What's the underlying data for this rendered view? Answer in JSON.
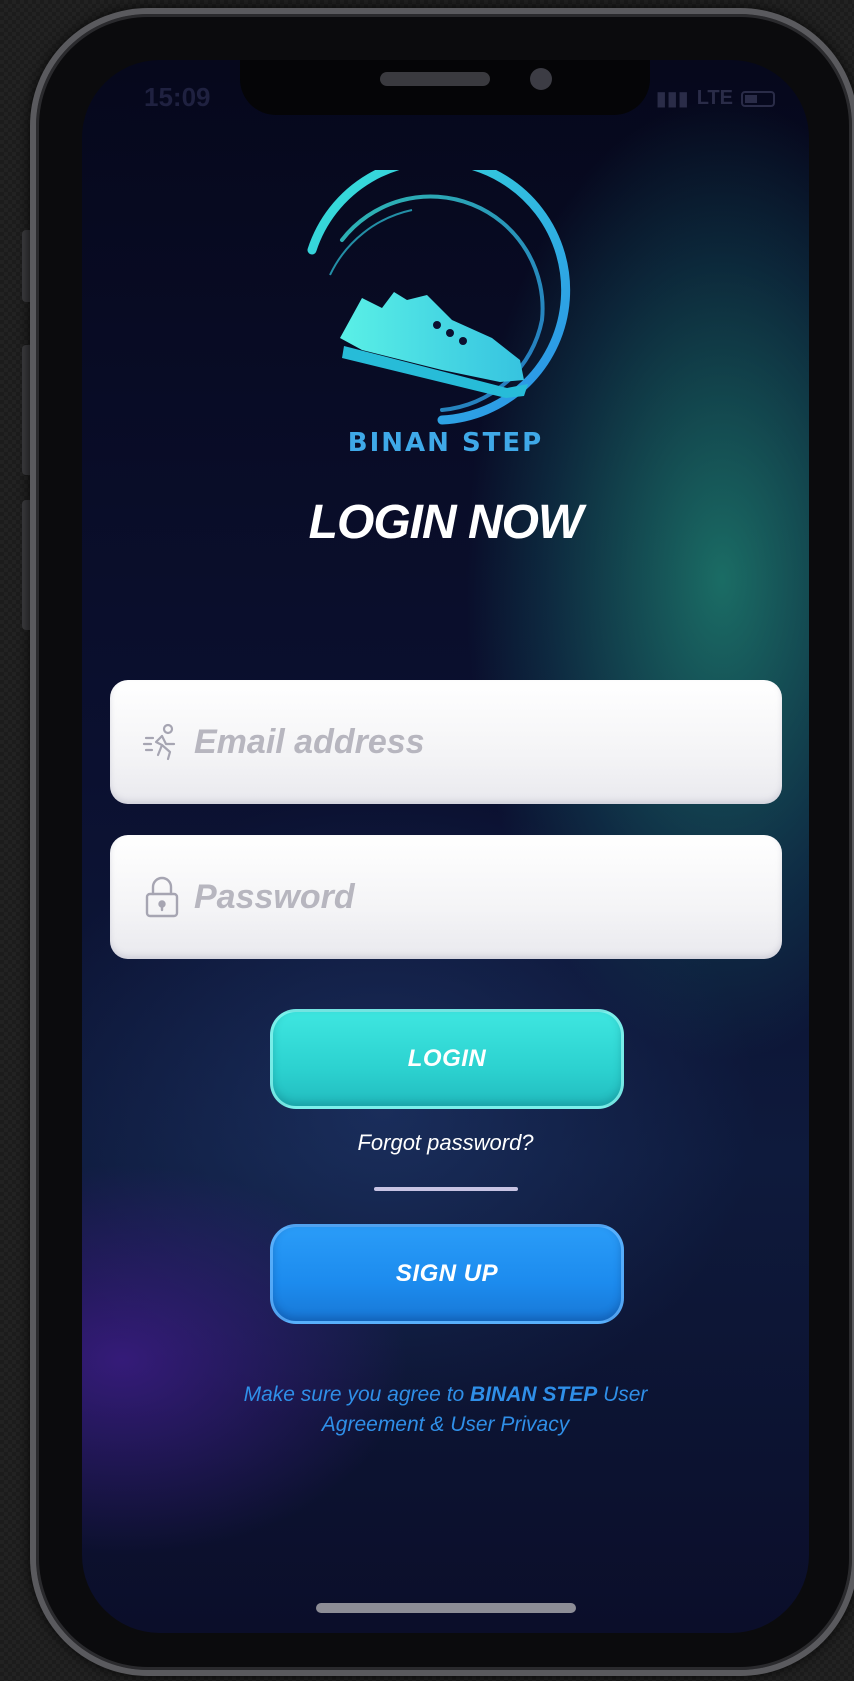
{
  "status_bar": {
    "time": "15:09",
    "network": "LTE"
  },
  "brand": {
    "name": "BINAN STEP",
    "logo_icon": "sneaker-icon"
  },
  "page_title": "LOGIN NOW",
  "form": {
    "email_placeholder": "Email address",
    "email_icon": "running-person-icon",
    "password_placeholder": "Password",
    "password_icon": "lock-icon"
  },
  "actions": {
    "login_label": "LOGIN",
    "forgot_label": "Forgot password?",
    "signup_label": "SIGN UP"
  },
  "agreement": {
    "prefix": "Make sure you agree to ",
    "brand": "BINAN STEP",
    "middle": " User Agreement ",
    "amp": "&",
    "suffix": " User Privacy"
  },
  "colors": {
    "accent_teal": "#2cd2d0",
    "accent_blue": "#1c8bee",
    "brand_text": "#3fa9e8",
    "background": "#0b1030"
  }
}
